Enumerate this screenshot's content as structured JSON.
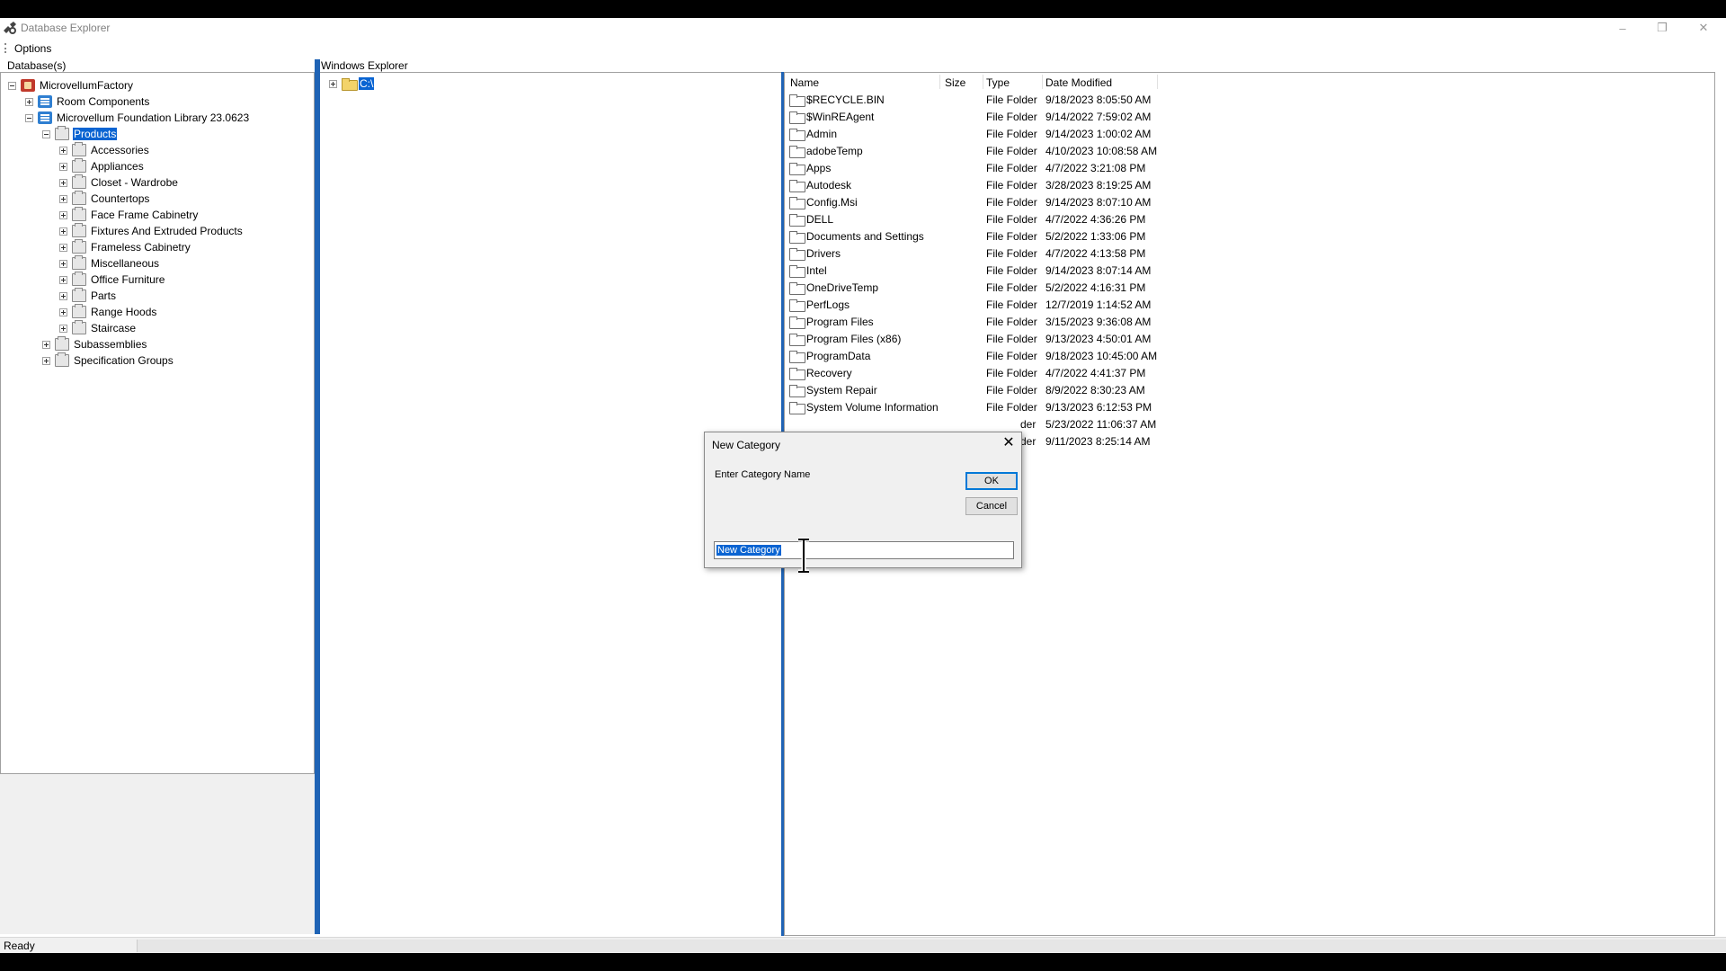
{
  "window": {
    "title": "Database Explorer",
    "minimize_glyph": "–",
    "maximize_glyph": "❐",
    "close_glyph": "✕"
  },
  "menu": {
    "options": "Options"
  },
  "left_panel": {
    "label": "Database(s)",
    "tree": [
      {
        "label": "MicrovellumFactory",
        "icon": "database-icon",
        "indent": 0,
        "expander": "minus"
      },
      {
        "label": "Room Components",
        "icon": "library-icon",
        "indent": 1,
        "expander": "plus"
      },
      {
        "label": "Microvellum Foundation Library 23.0623",
        "icon": "library-icon",
        "indent": 1,
        "expander": "minus"
      },
      {
        "label": "Products",
        "icon": "category-icon",
        "indent": 2,
        "expander": "minus",
        "selected": true
      },
      {
        "label": "Accessories",
        "icon": "category-icon",
        "indent": 3,
        "expander": "plus"
      },
      {
        "label": "Appliances",
        "icon": "category-icon",
        "indent": 3,
        "expander": "plus"
      },
      {
        "label": "Closet - Wardrobe",
        "icon": "category-icon",
        "indent": 3,
        "expander": "plus"
      },
      {
        "label": "Countertops",
        "icon": "category-icon",
        "indent": 3,
        "expander": "plus"
      },
      {
        "label": "Face Frame Cabinetry",
        "icon": "category-icon",
        "indent": 3,
        "expander": "plus"
      },
      {
        "label": "Fixtures And Extruded Products",
        "icon": "category-icon",
        "indent": 3,
        "expander": "plus"
      },
      {
        "label": "Frameless Cabinetry",
        "icon": "category-icon",
        "indent": 3,
        "expander": "plus"
      },
      {
        "label": "Miscellaneous",
        "icon": "category-icon",
        "indent": 3,
        "expander": "plus"
      },
      {
        "label": "Office Furniture",
        "icon": "category-icon",
        "indent": 3,
        "expander": "plus"
      },
      {
        "label": "Parts",
        "icon": "category-icon",
        "indent": 3,
        "expander": "plus"
      },
      {
        "label": "Range Hoods",
        "icon": "category-icon",
        "indent": 3,
        "expander": "plus"
      },
      {
        "label": "Staircase",
        "icon": "category-icon",
        "indent": 3,
        "expander": "plus"
      },
      {
        "label": "Subassemblies",
        "icon": "category-icon",
        "indent": 2,
        "expander": "plus"
      },
      {
        "label": "Specification Groups",
        "icon": "category-icon",
        "indent": 2,
        "expander": "plus"
      }
    ]
  },
  "explorer": {
    "label": "Windows Explorer",
    "drive": "C:\\",
    "columns": {
      "name": "Name",
      "size": "Size",
      "type": "Type",
      "date": "Date Modified"
    },
    "rows": [
      {
        "name": "$RECYCLE.BIN",
        "type": "File Folder",
        "date": "9/18/2023 8:05:50 AM"
      },
      {
        "name": "$WinREAgent",
        "type": "File Folder",
        "date": "9/14/2022 7:59:02 AM"
      },
      {
        "name": "Admin",
        "type": "File Folder",
        "date": "9/14/2023 1:00:02 AM"
      },
      {
        "name": "adobeTemp",
        "type": "File Folder",
        "date": "4/10/2023 10:08:58 AM"
      },
      {
        "name": "Apps",
        "type": "File Folder",
        "date": "4/7/2022 3:21:08 PM"
      },
      {
        "name": "Autodesk",
        "type": "File Folder",
        "date": "3/28/2023 8:19:25 AM"
      },
      {
        "name": "Config.Msi",
        "type": "File Folder",
        "date": "9/14/2023 8:07:10 AM"
      },
      {
        "name": "DELL",
        "type": "File Folder",
        "date": "4/7/2022 4:36:26 PM"
      },
      {
        "name": "Documents and Settings",
        "type": "File Folder",
        "date": "5/2/2022 1:33:06 PM"
      },
      {
        "name": "Drivers",
        "type": "File Folder",
        "date": "4/7/2022 4:13:58 PM"
      },
      {
        "name": "Intel",
        "type": "File Folder",
        "date": "9/14/2023 8:07:14 AM"
      },
      {
        "name": "OneDriveTemp",
        "type": "File Folder",
        "date": "5/2/2022 4:16:31 PM"
      },
      {
        "name": "PerfLogs",
        "type": "File Folder",
        "date": "12/7/2019 1:14:52 AM"
      },
      {
        "name": "Program Files",
        "type": "File Folder",
        "date": "3/15/2023 9:36:08 AM"
      },
      {
        "name": "Program Files (x86)",
        "type": "File Folder",
        "date": "9/13/2023 4:50:01 AM"
      },
      {
        "name": "ProgramData",
        "type": "File Folder",
        "date": "9/18/2023 10:45:00 AM"
      },
      {
        "name": "Recovery",
        "type": "File Folder",
        "date": "4/7/2022 4:41:37 PM"
      },
      {
        "name": "System Repair",
        "type": "File Folder",
        "date": "8/9/2022 8:30:23 AM"
      },
      {
        "name": "System Volume Information",
        "type": "File Folder",
        "date": "9/13/2023 6:12:53 PM"
      },
      {
        "name": "",
        "type": "der",
        "date": "5/23/2022 11:06:37 AM"
      },
      {
        "name": "",
        "type": "der",
        "date": "9/11/2023 8:25:14 AM"
      }
    ]
  },
  "status": {
    "text": "Ready"
  },
  "dialog": {
    "title": "New Category",
    "prompt": "Enter Category Name",
    "ok": "OK",
    "cancel": "Cancel",
    "input_value": "New Category",
    "close_glyph": "✕"
  }
}
